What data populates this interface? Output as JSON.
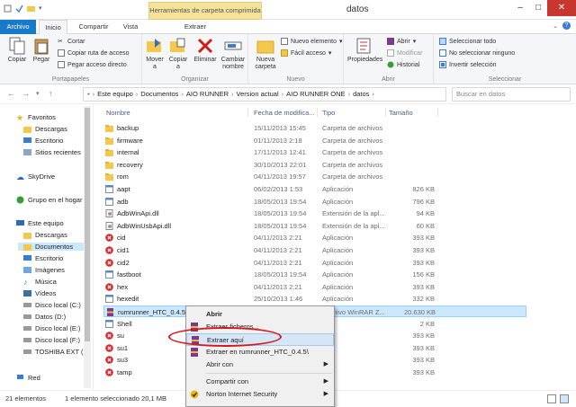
{
  "window": {
    "title": "datos",
    "context_tab_title": "Herramientas de carpeta comprimida"
  },
  "tabs": [
    "Archivo",
    "Inicio",
    "Compartir",
    "Vista",
    "Extraer"
  ],
  "ribbon": {
    "clipboard": {
      "label": "Portapapeles",
      "copy": "Copiar",
      "paste": "Pegar",
      "cut": "Cortar",
      "copy_path": "Copiar ruta de acceso",
      "paste_shortcut": "Pegar acceso directo"
    },
    "organize": {
      "label": "Organizar",
      "move": "Mover a",
      "copy": "Copiar a",
      "delete": "Eliminar",
      "rename": "Cambiar nombre"
    },
    "new": {
      "label": "Nuevo",
      "new_folder": "Nueva carpeta",
      "new_item": "Nuevo elemento",
      "easy_access": "Fácil acceso"
    },
    "open": {
      "label": "Abrir",
      "properties": "Propiedades",
      "open": "Abrir",
      "edit": "Modificar",
      "history": "Historial"
    },
    "select": {
      "label": "Seleccionar",
      "all": "Seleccionar todo",
      "none": "No seleccionar ninguno",
      "invert": "Invertir selección"
    }
  },
  "address": {
    "path": [
      "Este equipo",
      "Documentos",
      "AIO RUNNER",
      "Version actual",
      "AIO RUNNER ONE",
      "datos"
    ],
    "search_placeholder": "Buscar en datos"
  },
  "nav": {
    "favorites": "Favoritos",
    "downloads": "Descargas",
    "desktop": "Escritorio",
    "recent": "Sitios recientes",
    "skydrive": "SkyDrive",
    "homegroup": "Grupo en el hogar",
    "pc": "Este equipo",
    "pc_downloads": "Descargas",
    "pc_documents": "Documentos",
    "pc_desktop": "Escritorio",
    "images": "Imágenes",
    "music": "Música",
    "videos": "Vídeos",
    "disk_c": "Disco local (C:)",
    "disk_d": "Datos (D:)",
    "disk_e": "Disco local (E:)",
    "disk_f": "Disco local (F:)",
    "toshiba": "TOSHIBA EXT (H:",
    "network": "Red"
  },
  "columns": {
    "name": "Nombre",
    "date": "Fecha de modifica...",
    "type": "Tipo",
    "size": "Tamaño"
  },
  "files": [
    {
      "name": "backup",
      "date": "15/11/2013 15:45",
      "type": "Carpeta de archivos",
      "size": "",
      "icon": "folder"
    },
    {
      "name": "firmware",
      "date": "01/11/2013 2:18",
      "type": "Carpeta de archivos",
      "size": "",
      "icon": "folder"
    },
    {
      "name": "internal",
      "date": "17/11/2013 12:41",
      "type": "Carpeta de archivos",
      "size": "",
      "icon": "folder"
    },
    {
      "name": "recovery",
      "date": "30/10/2013 22:01",
      "type": "Carpeta de archivos",
      "size": "",
      "icon": "folder"
    },
    {
      "name": "rom",
      "date": "04/11/2013 19:57",
      "type": "Carpeta de archivos",
      "size": "",
      "icon": "folder"
    },
    {
      "name": "aapt",
      "date": "06/02/2013 1:53",
      "type": "Aplicación",
      "size": "826 KB",
      "icon": "app"
    },
    {
      "name": "adb",
      "date": "18/05/2013 19:54",
      "type": "Aplicación",
      "size": "796 KB",
      "icon": "app"
    },
    {
      "name": "AdbWinApi.dll",
      "date": "18/05/2013 19:54",
      "type": "Extensión de la apl...",
      "size": "94 KB",
      "icon": "dll"
    },
    {
      "name": "AdbWinUsbApi.dll",
      "date": "18/05/2013 19:54",
      "type": "Extensión de la apl...",
      "size": "60 KB",
      "icon": "dll"
    },
    {
      "name": "cid",
      "date": "04/11/2013 2:21",
      "type": "Aplicación",
      "size": "393 KB",
      "icon": "red"
    },
    {
      "name": "cid1",
      "date": "04/11/2013 2:21",
      "type": "Aplicación",
      "size": "393 KB",
      "icon": "red"
    },
    {
      "name": "cid2",
      "date": "04/11/2013 2:21",
      "type": "Aplicación",
      "size": "393 KB",
      "icon": "red"
    },
    {
      "name": "fastboot",
      "date": "18/05/2013 19:54",
      "type": "Aplicación",
      "size": "156 KB",
      "icon": "app"
    },
    {
      "name": "hex",
      "date": "04/11/2013 2:21",
      "type": "Aplicación",
      "size": "393 KB",
      "icon": "red"
    },
    {
      "name": "hexedit",
      "date": "25/10/2013 1:46",
      "type": "Aplicación",
      "size": "332 KB",
      "icon": "app"
    },
    {
      "name": "rumrunner_HTC_0.4.5",
      "date": "",
      "type": "Archivo WinRAR Z...",
      "size": "20.630 KB",
      "icon": "rar",
      "selected": true
    },
    {
      "name": "Shell",
      "date": "",
      "type": "",
      "size": "2 KB",
      "icon": "app"
    },
    {
      "name": "su",
      "date": "",
      "type": "",
      "size": "393 KB",
      "icon": "red"
    },
    {
      "name": "su1",
      "date": "",
      "type": "",
      "size": "393 KB",
      "icon": "red"
    },
    {
      "name": "su3",
      "date": "",
      "type": "",
      "size": "393 KB",
      "icon": "red"
    },
    {
      "name": "tamp",
      "date": "",
      "type": "",
      "size": "393 KB",
      "icon": "red"
    }
  ],
  "context_menu": {
    "open": "Abrir",
    "extract_files": "Extraer ficheros...",
    "extract_here": "Extraer aquí",
    "extract_to": "Extraer en rumrunner_HTC_0.4.5\\",
    "open_with": "Abrir con",
    "share_with": "Compartir con",
    "norton": "Norton Internet Security"
  },
  "status": {
    "count": "21 elementos",
    "selection": "1 elemento seleccionado  20,1 MB"
  },
  "colors": {
    "accent": "#1979ca",
    "selection": "#cce8ff",
    "highlight_oval": "#d7191e",
    "context_tab": "#f5e29a"
  }
}
